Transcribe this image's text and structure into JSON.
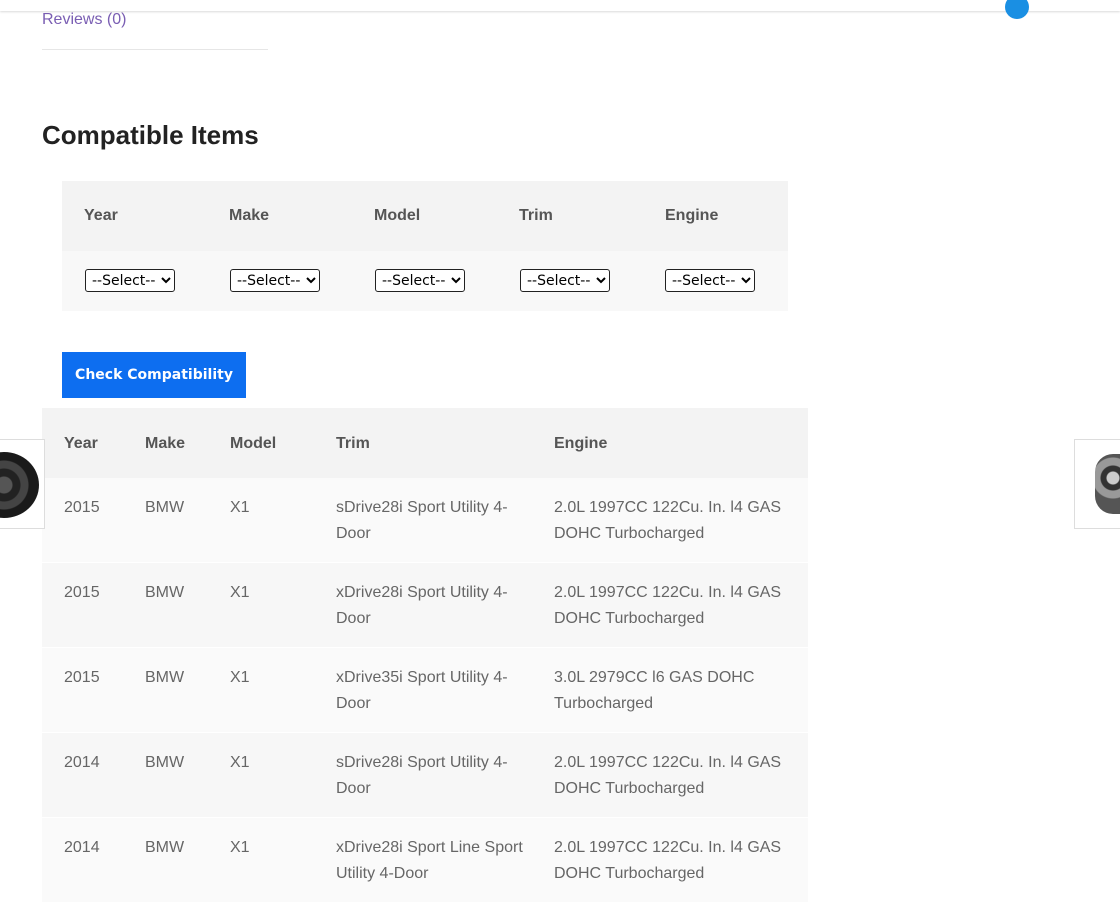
{
  "tabs": {
    "reviews": "Reviews (0)"
  },
  "section_title": "Compatible Items",
  "filters": {
    "labels": [
      "Year",
      "Make",
      "Model",
      "Trim",
      "Engine"
    ],
    "placeholder": "--Select--"
  },
  "check_button": "Check Compatibility",
  "results": {
    "headers": [
      "Year",
      "Make",
      "Model",
      "Trim",
      "Engine"
    ],
    "rows": [
      [
        "2015",
        "BMW",
        "X1",
        "sDrive28i Sport Utility 4-Door",
        "2.0L 1997CC 122Cu. In. l4 GAS DOHC Turbocharged"
      ],
      [
        "2015",
        "BMW",
        "X1",
        "xDrive28i Sport Utility 4-Door",
        "2.0L 1997CC 122Cu. In. l4 GAS DOHC Turbocharged"
      ],
      [
        "2015",
        "BMW",
        "X1",
        "xDrive35i Sport Utility 4-Door",
        "3.0L 2979CC l6 GAS DOHC Turbocharged"
      ],
      [
        "2014",
        "BMW",
        "X1",
        "sDrive28i Sport Utility 4-Door",
        "2.0L 1997CC 122Cu. In. l4 GAS DOHC Turbocharged"
      ],
      [
        "2014",
        "BMW",
        "X1",
        "xDrive28i Sport Line Sport Utility 4-Door",
        "2.0L 1997CC 122Cu. In. l4 GAS DOHC Turbocharged"
      ]
    ]
  },
  "thumbnails": {
    "left_icon": "radiator-fan-image",
    "right_icon": "engine-part-image"
  },
  "colors": {
    "accent": "#0d6ef0",
    "tab_link": "#7a5eb3",
    "dot": "#1a8fe3"
  }
}
